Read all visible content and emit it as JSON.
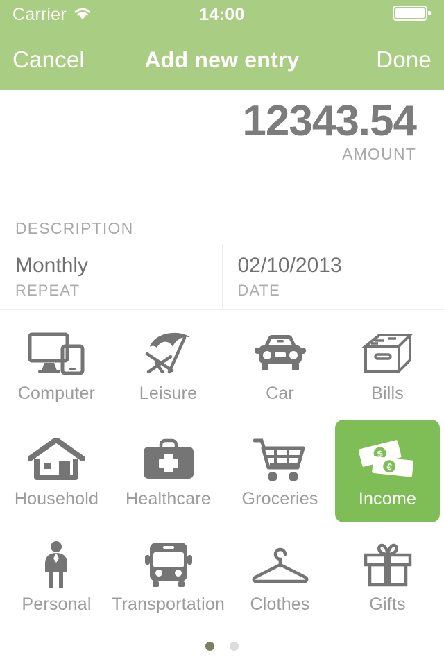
{
  "status_bar": {
    "carrier": "Carrier",
    "wifi_icon": "wifi-icon",
    "time": "14:00",
    "battery_icon": "battery-full-icon"
  },
  "nav_bar": {
    "cancel_label": "Cancel",
    "title": "Add new entry",
    "done_label": "Done"
  },
  "amount": {
    "value": "12343.54",
    "label": "AMOUNT"
  },
  "description": {
    "label": "DESCRIPTION",
    "value": "",
    "placeholder": ""
  },
  "repeat": {
    "value": "Monthly",
    "label": "REPEAT"
  },
  "date": {
    "value": "02/10/2013",
    "label": "DATE"
  },
  "categories": [
    {
      "label": "Computer",
      "icon": "computer-icon",
      "selected": false
    },
    {
      "label": "Leisure",
      "icon": "beach-umbrella-icon",
      "selected": false
    },
    {
      "label": "Car",
      "icon": "car-icon",
      "selected": false
    },
    {
      "label": "Bills",
      "icon": "file-box-icon",
      "selected": false
    },
    {
      "label": "Household",
      "icon": "house-icon",
      "selected": false
    },
    {
      "label": "Healthcare",
      "icon": "medical-bag-icon",
      "selected": false
    },
    {
      "label": "Groceries",
      "icon": "shopping-cart-icon",
      "selected": false
    },
    {
      "label": "Income",
      "icon": "banknotes-icon",
      "selected": true
    },
    {
      "label": "Personal",
      "icon": "person-icon",
      "selected": false
    },
    {
      "label": "Transportation",
      "icon": "bus-icon",
      "selected": false
    },
    {
      "label": "Clothes",
      "icon": "hanger-icon",
      "selected": false
    },
    {
      "label": "Gifts",
      "icon": "gift-box-icon",
      "selected": false
    }
  ],
  "pagination": {
    "pages": 2,
    "active_page": 1
  },
  "colors": {
    "nav_green": "#a9ce83",
    "selected_green": "#7fbd56",
    "icon_gray": "#757575",
    "label_gray": "#9c9c9c",
    "amount_gray": "#7c7c7c",
    "dot_active": "#7d7f63",
    "dot_inactive": "#dcdcdc"
  }
}
